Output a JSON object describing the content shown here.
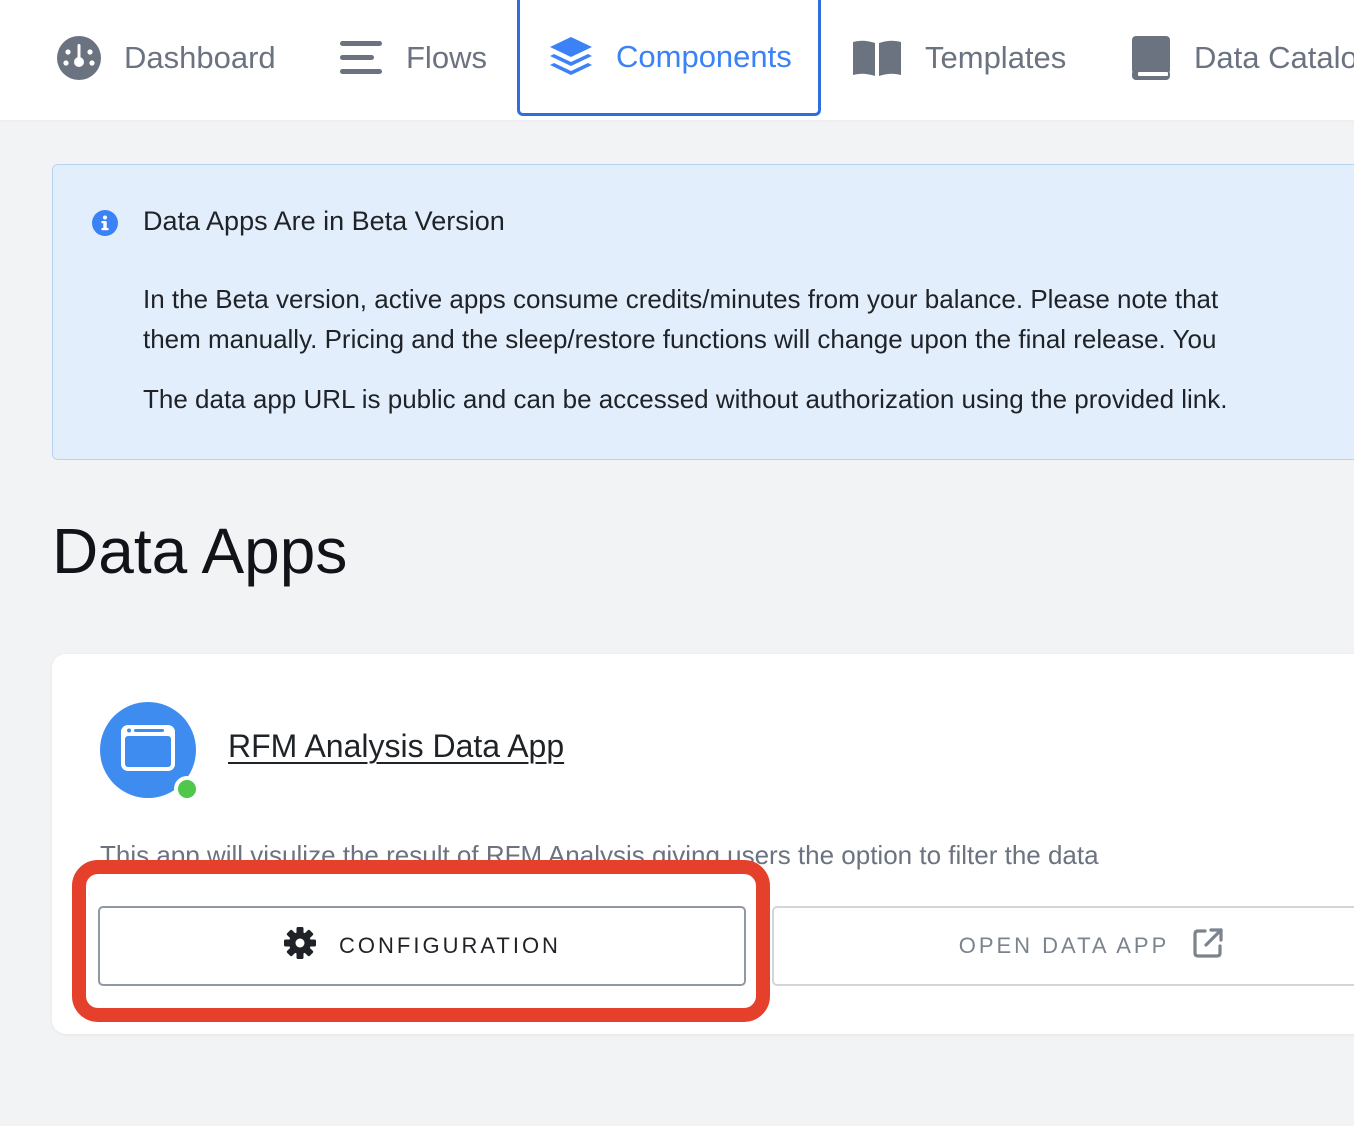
{
  "nav": {
    "items": [
      {
        "label": "Dashboard",
        "icon": "dashboard-gauge-icon",
        "active": false
      },
      {
        "label": "Flows",
        "icon": "flows-lines-icon",
        "active": false
      },
      {
        "label": "Components",
        "icon": "layers-icon",
        "active": true
      },
      {
        "label": "Templates",
        "icon": "book-open-icon",
        "active": false
      },
      {
        "label": "Data Catalog",
        "icon": "book-closed-icon",
        "active": false
      }
    ]
  },
  "banner": {
    "icon": "info-icon",
    "title": "Data Apps Are in Beta Version",
    "paragraph1_line1": "In the Beta version, active apps consume credits/minutes from your balance. Please note that",
    "paragraph1_line2": "them manually. Pricing and the sleep/restore functions will change upon the final release. You",
    "paragraph2": "The data app URL is public and can be accessed without authorization using the provided link."
  },
  "page": {
    "title": "Data Apps"
  },
  "app": {
    "name": "RFM Analysis Data App",
    "status": "running",
    "description": "This app will visulize the result of RFM Analysis giving users the option to filter the data",
    "configuration_label": "CONFIGURATION",
    "open_label": "OPEN DATA APP"
  },
  "colors": {
    "accent": "#3b82f6",
    "active_border": "#2f6fdb",
    "banner_bg": "#e2eefb",
    "status_green": "#4ec74a",
    "highlight_red": "#e5402b"
  }
}
